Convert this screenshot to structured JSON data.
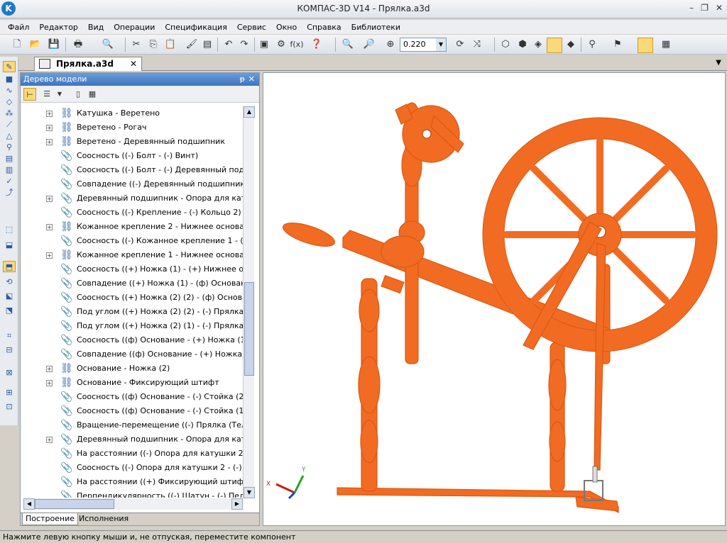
{
  "window": {
    "title": "КОМПАС-3D V14 - Прялка.a3d",
    "app_icon_letter": "K",
    "controls": [
      "–",
      "❐",
      "✕"
    ]
  },
  "menu": [
    "Файл",
    "Редактор",
    "Вид",
    "Операции",
    "Спецификация",
    "Сервис",
    "Окно",
    "Справка",
    "Библиотеки"
  ],
  "toolbar": {
    "zoom_value": "0.220",
    "fx_label": "f(x)"
  },
  "document": {
    "tab_title": "Прялка.a3d",
    "tab_close": "✕"
  },
  "tree_panel": {
    "title": "Дерево модели",
    "pin": "ᵽ",
    "close": "✕",
    "rows": [
      {
        "expander": "+",
        "icon": "asm",
        "label": "Катушка - Веретено"
      },
      {
        "expander": "+",
        "icon": "asm",
        "label": "Веретено - Рогач"
      },
      {
        "expander": "+",
        "icon": "asm",
        "label": "Веретено - Деревянный подшипник"
      },
      {
        "expander": "",
        "icon": "clip",
        "label": "Соосность ((-) Болт  -  (-) Винт)"
      },
      {
        "expander": "",
        "icon": "clip",
        "label": "Соосность ((-) Болт  -  (-) Деревянный подши"
      },
      {
        "expander": "",
        "icon": "clip",
        "label": "Совпадение ((-) Деревянный подшипник  -  (-"
      },
      {
        "expander": "+",
        "icon": "clip",
        "label": "Деревянный подшипник - Опора для катушк"
      },
      {
        "expander": "",
        "icon": "clip",
        "label": "Соосность ((-) Крепление  -  (-) Кольцо 2)"
      },
      {
        "expander": "+",
        "icon": "asm",
        "label": "Кожанное крепление 2 - Нижнее основание"
      },
      {
        "expander": "",
        "icon": "clip",
        "label": "Соосность ((-) Кожанное крепление 1  -  (-) П"
      },
      {
        "expander": "+",
        "icon": "asm",
        "label": "Кожанное крепление 1 - Нижнее основание"
      },
      {
        "expander": "",
        "icon": "clip",
        "label": "Соосность ((+) Ножка (1)  -  (+) Нижнее осно"
      },
      {
        "expander": "",
        "icon": "clip",
        "label": "Совпадение ((+) Ножка (1)  -  (ф) Основание)"
      },
      {
        "expander": "",
        "icon": "clip",
        "label": "Соосность ((+) Ножка (2) (2)  -  (ф) Основани"
      },
      {
        "expander": "",
        "icon": "clip",
        "label": "Под углом ((+) Ножка (2) (2)  -  (-) Прялка (Те"
      },
      {
        "expander": "",
        "icon": "clip",
        "label": "Под углом ((+) Ножка (2) (1)  -  (-) Прялка (Те"
      },
      {
        "expander": "",
        "icon": "clip",
        "label": "Соосность ((ф) Основание  -  (+) Ножка (1))"
      },
      {
        "expander": "",
        "icon": "clip",
        "label": "Совпадение ((ф) Основание  -  (+) Ножка (2) ("
      },
      {
        "expander": "+",
        "icon": "asm",
        "label": "Основание - Ножка (2)"
      },
      {
        "expander": "+",
        "icon": "asm",
        "label": "Основание - Фиксирующий штифт"
      },
      {
        "expander": "",
        "icon": "clip",
        "label": "Соосность ((ф) Основание  -  (-) Стойка (2))"
      },
      {
        "expander": "",
        "icon": "clip",
        "label": "Соосность ((ф) Основание  -  (-) Стойка (1))"
      },
      {
        "expander": "",
        "icon": "clip",
        "label": "Вращение-перемещение ((-) Прялка (Тел-0, С"
      },
      {
        "expander": "+",
        "icon": "clip",
        "label": "Деревянный подшипник - Опора для катушк"
      },
      {
        "expander": "",
        "icon": "clip",
        "label": "На расстоянии ((-) Опора для катушки 2  -  (-)"
      },
      {
        "expander": "",
        "icon": "clip",
        "label": "Соосность ((-) Опора для катушки 2  -  (-) Нат"
      },
      {
        "expander": "",
        "icon": "clip",
        "label": "На расстоянии ((+) Фиксирующий штифт  -  (-"
      },
      {
        "expander": "",
        "icon": "clip",
        "label": "Перпендикулярность ((-) Шатун  -  (-) Педал"
      }
    ],
    "bottom_tabs": [
      "Построение",
      "Исполнения"
    ]
  },
  "viewport": {
    "axis_x": "X",
    "axis_y": "Y",
    "model_color": "#f26b22"
  },
  "status": "Нажмите левую кнопку мыши и, не отпуская, переместите компонент"
}
